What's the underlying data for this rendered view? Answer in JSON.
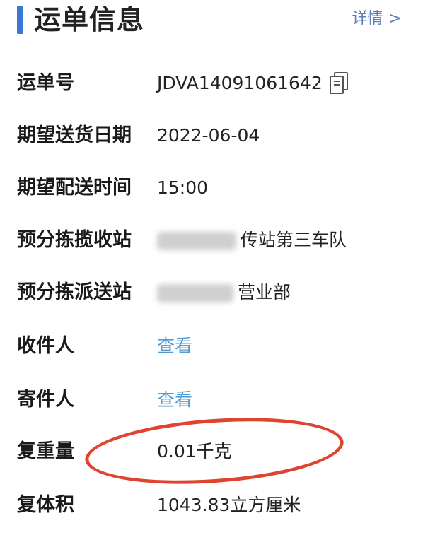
{
  "header": {
    "title": "运单信息",
    "details_label": "详情",
    "chevron": ">"
  },
  "rows": [
    {
      "label": "运单号",
      "value": "JDVA14091061642"
    },
    {
      "label": "期望送货日期",
      "value": "2022-06-04"
    },
    {
      "label": "期望配送时间",
      "value": "15:00"
    },
    {
      "label": "预分拣揽收站",
      "value": "传站第三车队"
    },
    {
      "label": "预分拣派送站",
      "value": "营业部"
    },
    {
      "label": "收件人",
      "value": "查看"
    },
    {
      "label": "寄件人",
      "value": "查看"
    },
    {
      "label": "复重量",
      "value": "0.01千克"
    },
    {
      "label": "复体积",
      "value": "1043.83立方厘米"
    }
  ],
  "colors": {
    "accent": "#3a78d6",
    "link": "#4f9bd6",
    "annotation": "#e0432f"
  },
  "icons": [
    "copy-icon",
    "chevron-right-icon"
  ]
}
